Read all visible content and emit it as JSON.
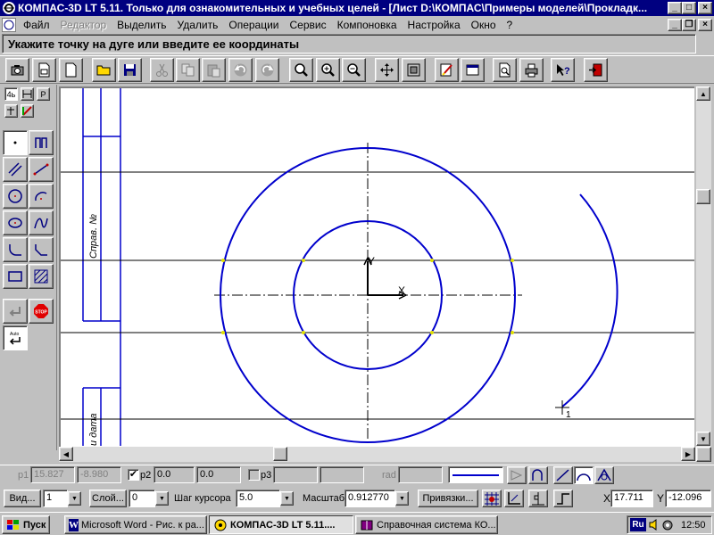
{
  "title": "КОМПАС-3D LT 5.11. Только для ознакомительных и учебных целей - [Лист D:\\КОМПАС\\Примеры моделей\\Прокладк...",
  "window_controls": {
    "minimize": "_",
    "maximize": "□",
    "close": "×"
  },
  "menu": [
    "Файл",
    "Редактор",
    "Выделить",
    "Удалить",
    "Операции",
    "Сервис",
    "Компоновка",
    "Настройка",
    "Окно",
    "?"
  ],
  "mdi_controls": {
    "minimize": "_",
    "restore": "❐",
    "close": "×"
  },
  "prompt": "Укажите точку на дуге или введите ее координаты",
  "left_tabs": [
    "4ь",
    "Р"
  ],
  "canvas": {
    "axis_x": "X",
    "axis_y": "Y",
    "frame_text_1": "Справ. №",
    "frame_text_2": "и дата",
    "cursor_label": "1"
  },
  "colors": {
    "drawing_blue": "#0000cc",
    "selected_green": "#00a000",
    "point_yellow": "#e0e000"
  },
  "status": {
    "p1_label": "p1",
    "p1_x": "15.827",
    "p1_y": "-8.980",
    "p2_label": "p2",
    "p2_check": "✔",
    "p2_x": "0.0",
    "p2_y": "0.0",
    "p3_label": "p3",
    "rad_label": "rad"
  },
  "bottom": {
    "view_label": "Вид...",
    "view_value": "1",
    "layer_label": "Слой...",
    "layer_value": "0",
    "step_label": "Шаг курсора",
    "step_value": "5.0",
    "scale_label": "Масштаб",
    "scale_value": "0.912770",
    "snap_label": "Привязки...",
    "x_label": "X",
    "x_value": "17.711",
    "y_label": "Y",
    "y_value": "-12.096"
  },
  "taskbar": {
    "start": "Пуск",
    "items": [
      "Microsoft Word - Рис. к ра...",
      "КОМПАС-3D LT 5.11....",
      "Справочная система КО..."
    ],
    "lang": "Ru",
    "time": "12:50"
  }
}
